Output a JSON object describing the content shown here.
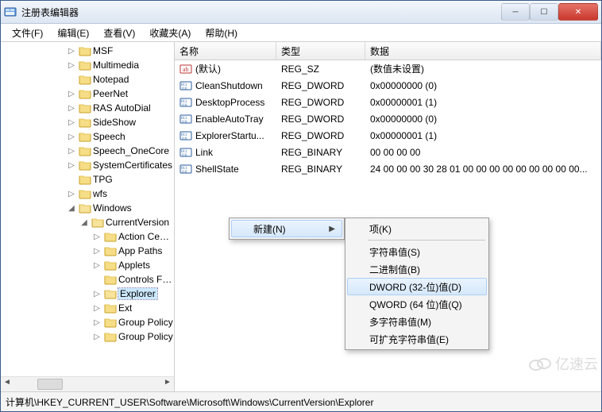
{
  "title": "注册表编辑器",
  "menu": {
    "file": "文件(F)",
    "edit": "编辑(E)",
    "view": "查看(V)",
    "favorites": "收藏夹(A)",
    "help": "帮助(H)"
  },
  "tree": {
    "items": [
      {
        "label": "MSF",
        "exp": "▷"
      },
      {
        "label": "Multimedia",
        "exp": "▷"
      },
      {
        "label": "Notepad",
        "exp": ""
      },
      {
        "label": "PeerNet",
        "exp": "▷"
      },
      {
        "label": "RAS AutoDial",
        "exp": "▷"
      },
      {
        "label": "SideShow",
        "exp": "▷"
      },
      {
        "label": "Speech",
        "exp": "▷"
      },
      {
        "label": "Speech_OneCore",
        "exp": "▷"
      },
      {
        "label": "SystemCertificates",
        "exp": "▷"
      },
      {
        "label": "TPG",
        "exp": ""
      },
      {
        "label": "wfs",
        "exp": "▷"
      }
    ],
    "windows": {
      "label": "Windows",
      "exp": "◢",
      "currentversion": {
        "label": "CurrentVersion",
        "exp": "◢",
        "children": [
          {
            "label": "Action Center",
            "exp": "▷"
          },
          {
            "label": "App Paths",
            "exp": "▷"
          },
          {
            "label": "Applets",
            "exp": "▷"
          },
          {
            "label": "Controls Folder",
            "exp": ""
          },
          {
            "label": "Explorer",
            "exp": "▷",
            "selected": true
          },
          {
            "label": "Ext",
            "exp": "▷"
          },
          {
            "label": "Group Policy",
            "exp": "▷"
          },
          {
            "label": "Group Policy",
            "exp": "▷"
          }
        ]
      }
    }
  },
  "columns": {
    "name": "名称",
    "type": "类型",
    "data": "数据"
  },
  "rows": [
    {
      "icon": "str",
      "name": "(默认)",
      "type": "REG_SZ",
      "data": "(数值未设置)"
    },
    {
      "icon": "bin",
      "name": "CleanShutdown",
      "type": "REG_DWORD",
      "data": "0x00000000 (0)"
    },
    {
      "icon": "bin",
      "name": "DesktopProcess",
      "type": "REG_DWORD",
      "data": "0x00000001 (1)"
    },
    {
      "icon": "bin",
      "name": "EnableAutoTray",
      "type": "REG_DWORD",
      "data": "0x00000000 (0)"
    },
    {
      "icon": "bin",
      "name": "ExplorerStartu...",
      "type": "REG_DWORD",
      "data": "0x00000001 (1)"
    },
    {
      "icon": "bin",
      "name": "Link",
      "type": "REG_BINARY",
      "data": "00 00 00 00"
    },
    {
      "icon": "bin",
      "name": "ShellState",
      "type": "REG_BINARY",
      "data": "24 00 00 00 30 28 01 00 00 00 00 00 00 00 00 00..."
    }
  ],
  "context1": {
    "new": "新建(N)"
  },
  "context2": {
    "key": "项(K)",
    "string": "字符串值(S)",
    "binary": "二进制值(B)",
    "dword": "DWORD (32-位)值(D)",
    "qword": "QWORD (64 位)值(Q)",
    "multistring": "多字符串值(M)",
    "expandstring": "可扩充字符串值(E)"
  },
  "statusbar": "计算机\\HKEY_CURRENT_USER\\Software\\Microsoft\\Windows\\CurrentVersion\\Explorer",
  "watermark": "亿速云"
}
